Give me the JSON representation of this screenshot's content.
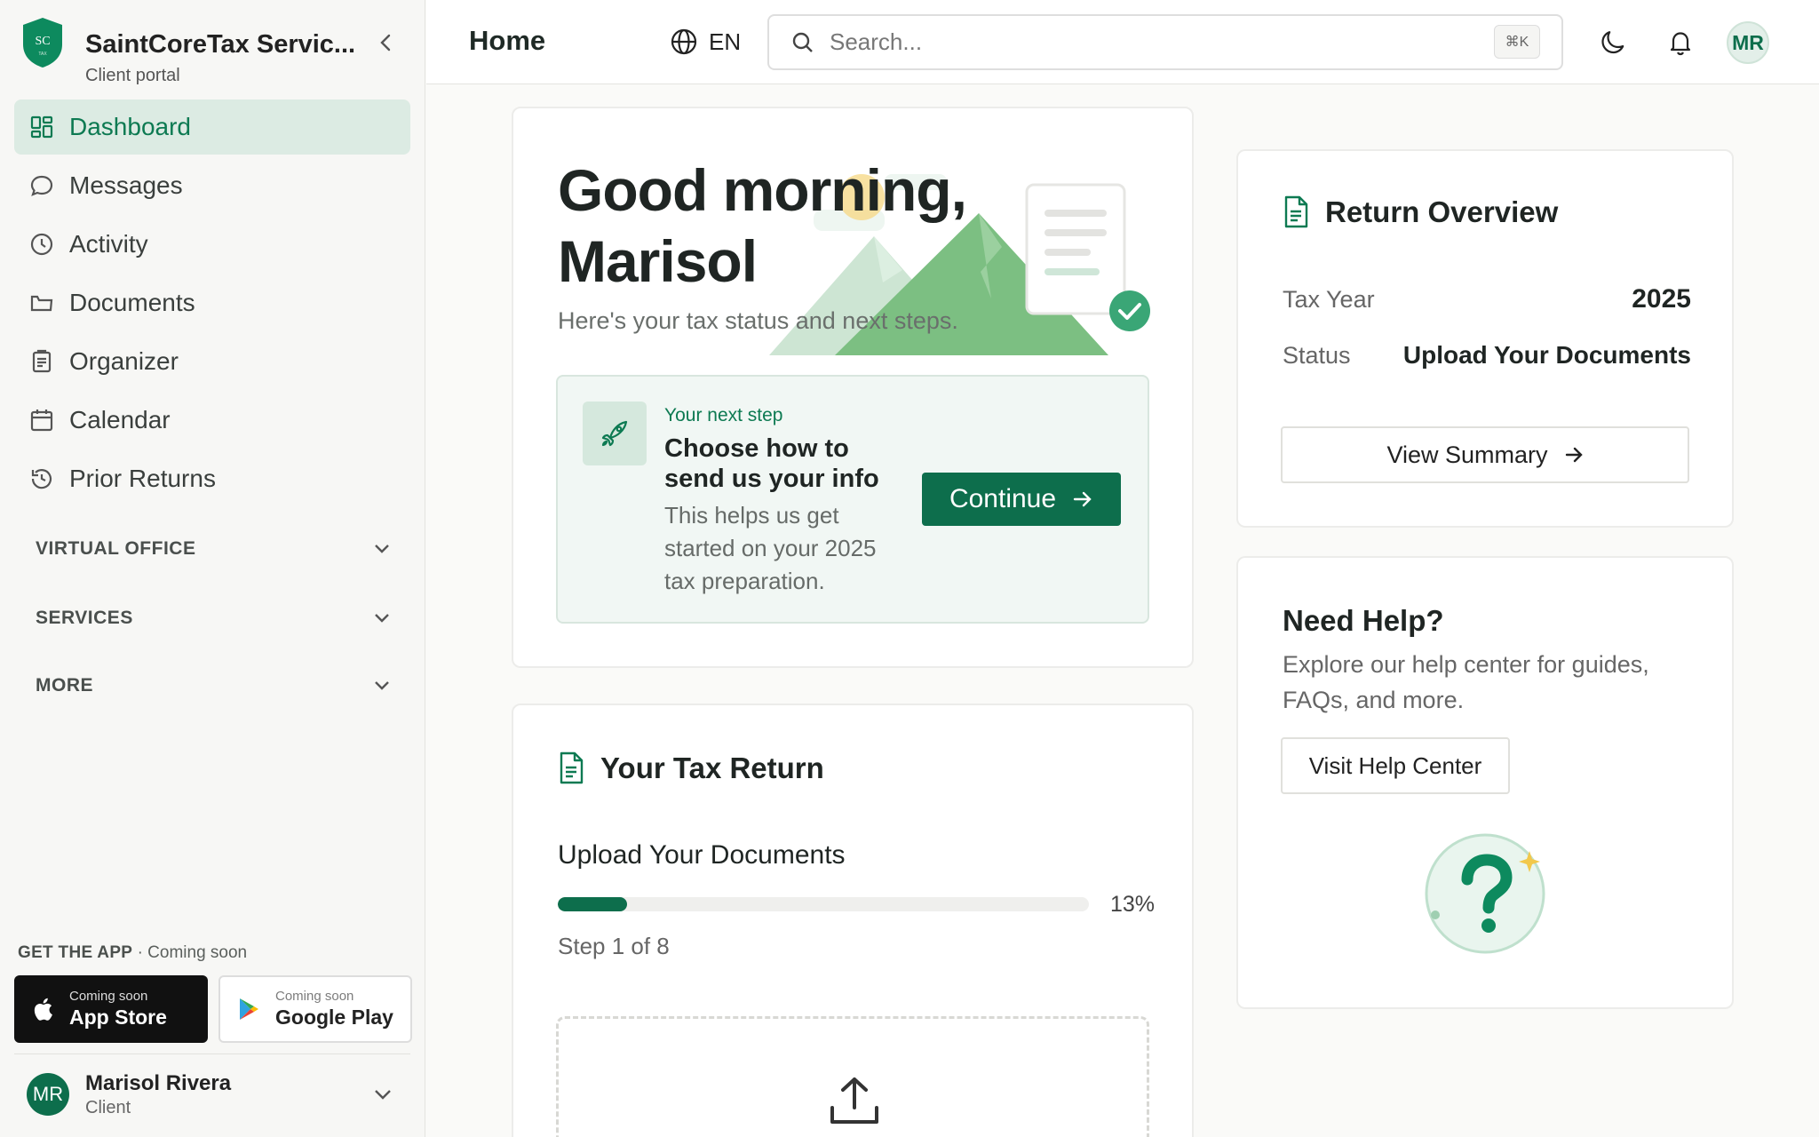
{
  "brand": {
    "name": "SaintCoreTax Servic...",
    "subtitle": "Client portal",
    "logo_text": "SC"
  },
  "sidebar": {
    "items": [
      {
        "label": "Dashboard",
        "icon": "grid-icon",
        "active": true
      },
      {
        "label": "Messages",
        "icon": "chat-icon"
      },
      {
        "label": "Activity",
        "icon": "clock-icon"
      },
      {
        "label": "Documents",
        "icon": "folder-icon"
      },
      {
        "label": "Organizer",
        "icon": "clipboard-icon"
      },
      {
        "label": "Calendar",
        "icon": "calendar-icon"
      },
      {
        "label": "Prior Returns",
        "icon": "history-icon"
      }
    ],
    "sections": [
      "VIRTUAL OFFICE",
      "SERVICES",
      "MORE"
    ],
    "get_app": {
      "label": "GET THE APP",
      "note": "· Coming soon"
    },
    "stores": [
      {
        "small": "Coming soon",
        "big": "App Store"
      },
      {
        "small": "Coming soon",
        "big": "Google Play"
      }
    ],
    "user": {
      "initials": "MR",
      "name": "Marisol Rivera",
      "role": "Client"
    }
  },
  "topbar": {
    "title": "Home",
    "language": "EN",
    "search_placeholder": "Search...",
    "shortcut": "⌘K",
    "avatar_initials": "MR"
  },
  "hero": {
    "greeting": "Good morning,",
    "name": "Marisol",
    "subtitle": "Here's your tax status and next steps.",
    "next_step": {
      "kicker": "Your next step",
      "title": "Choose how to send us your info",
      "body": "This helps us get started on your 2025 tax preparation.",
      "button": "Continue"
    }
  },
  "tax_return": {
    "title": "Your Tax Return",
    "status": "Upload Your Documents",
    "progress_percent": 13,
    "percent_label": "13%",
    "step": "Step 1 of 8"
  },
  "overview": {
    "title": "Return Overview",
    "rows": [
      {
        "key": "Tax Year",
        "value": "2025"
      },
      {
        "key": "Status",
        "value": "Upload Your Documents"
      }
    ],
    "button": "View Summary"
  },
  "help": {
    "title": "Need Help?",
    "body": "Explore our help center for guides, FAQs, and more.",
    "button": "Visit Help Center"
  },
  "colors": {
    "accent": "#0d6e4c",
    "active_bg": "#dcebe3",
    "card_border": "#ececea"
  }
}
